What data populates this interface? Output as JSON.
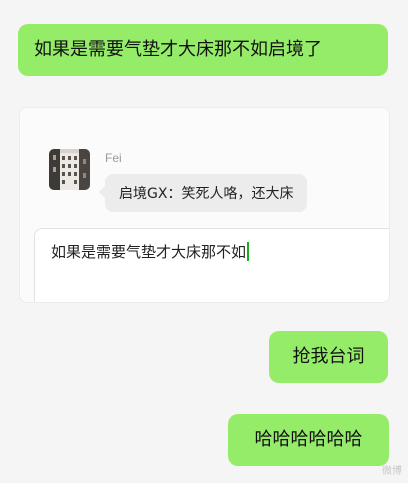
{
  "messages": {
    "outgoing_1": "如果是需要气垫才大床那不如启境了",
    "outgoing_2": "抢我台词",
    "outgoing_3": "哈哈哈哈哈哈"
  },
  "screenshot": {
    "sender_name": "Fei",
    "incoming_message": "启境GX：笑死人咯，还大床",
    "input_text": "如果是需要气垫才大床那不如"
  },
  "colors": {
    "outgoing_bubble": "#95ec69",
    "incoming_bubble": "#ececec",
    "cursor": "#1aad19"
  },
  "icons": {
    "avatar": "building-photo-avatar"
  },
  "watermark": "微博"
}
